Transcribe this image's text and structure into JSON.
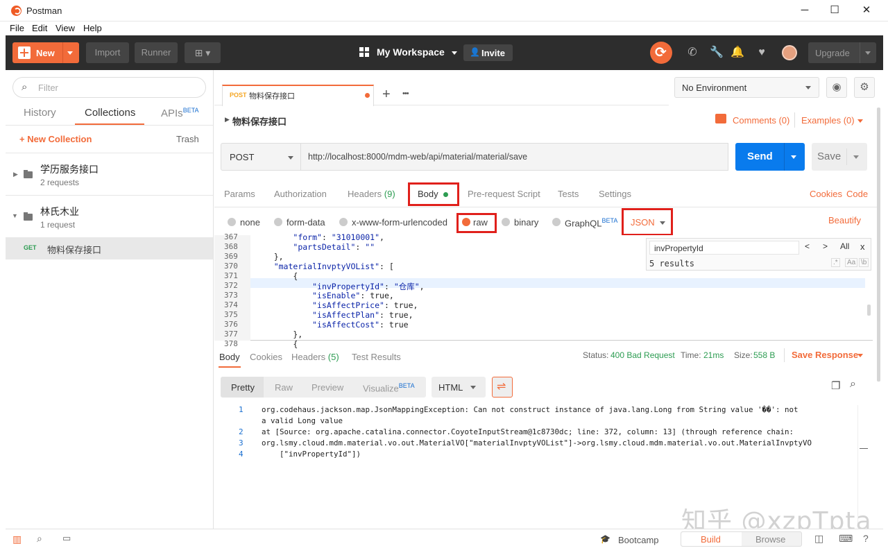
{
  "window": {
    "title": "Postman",
    "minimize": "─",
    "maximize": "☐",
    "close": "✕"
  },
  "menu": [
    "File",
    "Edit",
    "View",
    "Help"
  ],
  "header": {
    "new_label": "New",
    "import_label": "Import",
    "runner_label": "Runner",
    "workspace_label": "My Workspace",
    "invite_label": "Invite",
    "upgrade_label": "Upgrade"
  },
  "sidebar": {
    "filter_placeholder": "Filter",
    "tabs": {
      "history": "History",
      "collections": "Collections",
      "apis": "APIs",
      "apis_badge": "BETA"
    },
    "new_collection": "+ New Collection",
    "trash": "Trash",
    "collections": [
      {
        "name": "学历服务接口",
        "count": "2 requests"
      },
      {
        "name": "林氏木业",
        "count": "1 request"
      }
    ],
    "request": {
      "method": "GET",
      "name": "物料保存接口"
    }
  },
  "request_tab": {
    "method": "POST",
    "name": "物料保存接口",
    "add": "+",
    "more": "•••"
  },
  "environment": {
    "selected": "No Environment"
  },
  "request": {
    "title": "物料保存接口",
    "comments": "Comments (0)",
    "examples": "Examples (0)",
    "method": "POST",
    "url": "http://localhost:8000/mdm-web/api/material/material/save",
    "send_label": "Send",
    "save_label": "Save",
    "tabs": [
      "Params",
      "Authorization",
      "Headers",
      "Body",
      "Pre-request Script",
      "Tests",
      "Settings"
    ],
    "headers_count": "(9)",
    "cookies": "Cookies",
    "code": "Code",
    "body_types": [
      "none",
      "form-data",
      "x-www-form-urlencoded",
      "raw",
      "binary",
      "GraphQL"
    ],
    "graphql_badge": "BETA",
    "format": "JSON",
    "beautify": "Beautify"
  },
  "editor": {
    "lines": [
      {
        "n": "367",
        "code": "        \"form\": \"31010001\","
      },
      {
        "n": "368",
        "code": "        \"partsDetail\": \"\""
      },
      {
        "n": "369",
        "code": "    },"
      },
      {
        "n": "370",
        "code": "    \"materialInvptyVOList\": ["
      },
      {
        "n": "371",
        "code": "        {"
      },
      {
        "n": "372",
        "code": "            \"invPropertyId\": \"仓库\","
      },
      {
        "n": "373",
        "code": "            \"isEnable\": true,"
      },
      {
        "n": "374",
        "code": "            \"isAffectPrice\": true,"
      },
      {
        "n": "375",
        "code": "            \"isAffectPlan\": true,"
      },
      {
        "n": "376",
        "code": "            \"isAffectCost\": true"
      },
      {
        "n": "377",
        "code": "        },"
      },
      {
        "n": "378",
        "code": "        {"
      }
    ],
    "find": {
      "query": "invPropertyId",
      "results": "5 results",
      "prev": "<",
      "next": ">",
      "all": "All",
      "close": "x",
      "regex": ".*",
      "case": "Aa",
      "word": "\\b"
    }
  },
  "response": {
    "tabs": [
      "Body",
      "Cookies",
      "Headers",
      "Test Results"
    ],
    "headers_count": "(5)",
    "status_label": "Status:",
    "status_value": "400 Bad Request",
    "time_label": "Time:",
    "time_value": "21ms",
    "size_label": "Size:",
    "size_value": "558 B",
    "save_response": "Save Response",
    "views": [
      "Pretty",
      "Raw",
      "Preview",
      "Visualize"
    ],
    "visualize_badge": "BETA",
    "format": "HTML",
    "lines": [
      {
        "n": "1",
        "text": "org.codehaus.jackson.map.JsonMappingException: Can not construct instance of java.lang.Long from String value '��': not"
      },
      {
        "n": "",
        "text": "a valid Long value"
      },
      {
        "n": "2",
        "text": "at [Source: org.apache.catalina.connector.CoyoteInputStream@1c8730dc; line: 372, column: 13] (through reference chain:"
      },
      {
        "n": "3",
        "text": "org.lsmy.cloud.mdm.material.vo.out.MaterialVO[\"materialInvptyVOList\"]->org.lsmy.cloud.mdm.material.vo.out.MaterialInvptyVO"
      },
      {
        "n": "4",
        "text": "    [\"invPropertyId\"])"
      }
    ]
  },
  "footer": {
    "bootcamp": "Bootcamp",
    "build": "Build",
    "browse": "Browse"
  },
  "watermark": "知乎 @xzpTpta",
  "colors": {
    "accent": "#f26b3a",
    "send": "#097bed",
    "highlight_box": "#e0201b",
    "status_ok": "#2d9c52"
  }
}
